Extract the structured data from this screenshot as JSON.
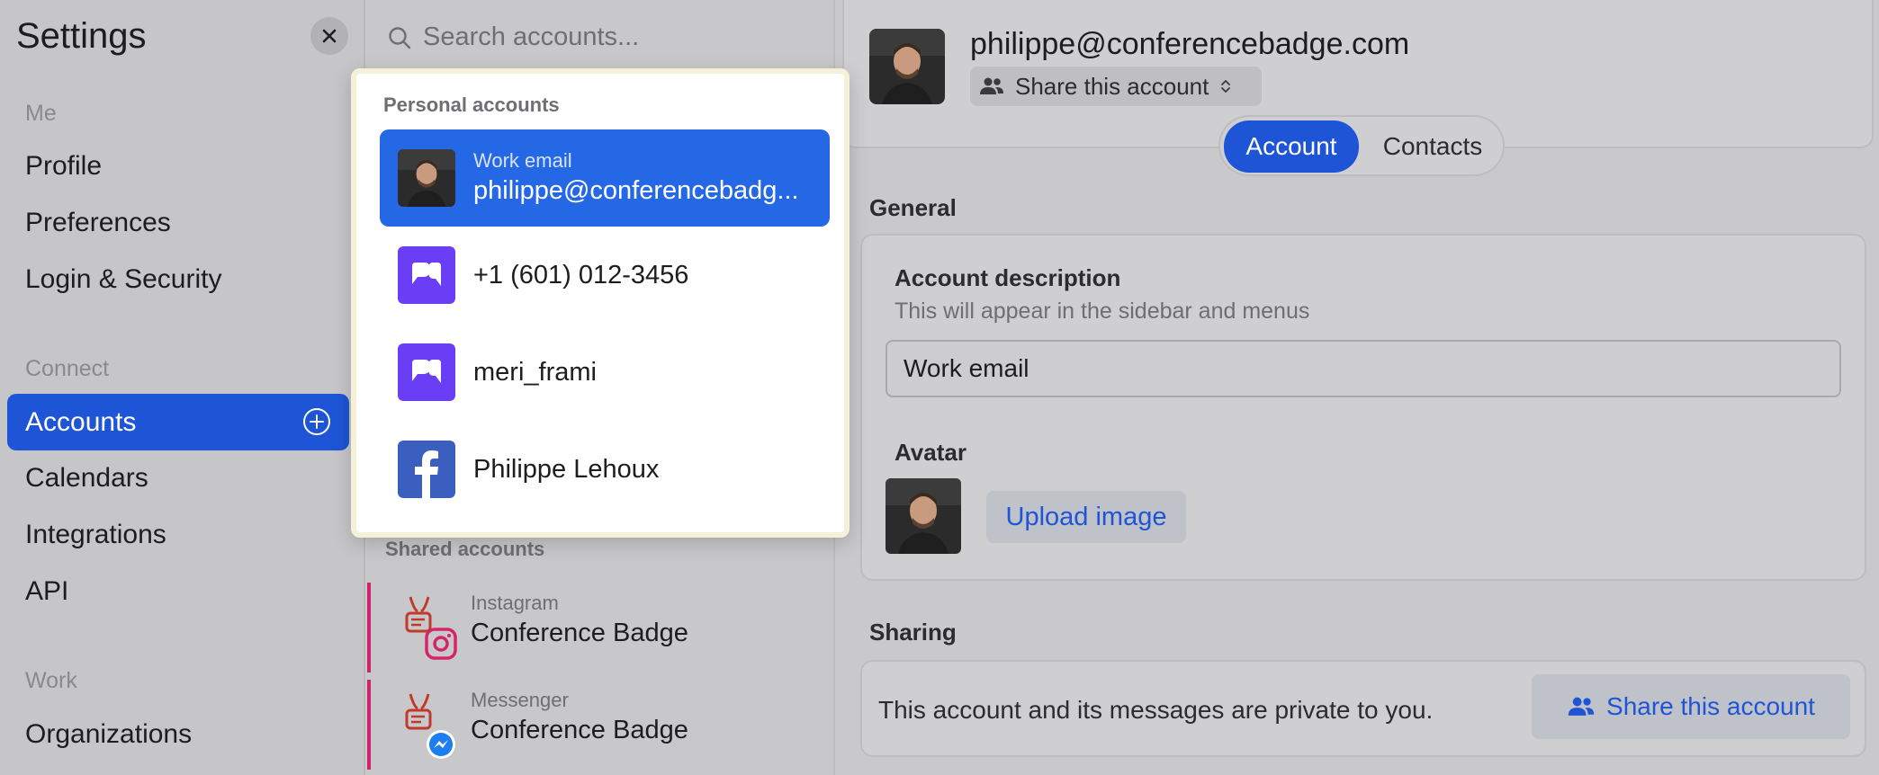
{
  "sidebar": {
    "title": "Settings",
    "sections": [
      {
        "label": "Me",
        "items": [
          "Profile",
          "Preferences",
          "Login & Security"
        ]
      },
      {
        "label": "Connect",
        "items": [
          "Accounts",
          "Calendars",
          "Integrations",
          "API"
        ]
      },
      {
        "label": "Work",
        "items": [
          "Organizations"
        ]
      }
    ],
    "active_item": "Accounts",
    "accent": "#1e55d6"
  },
  "search": {
    "placeholder": "Search accounts..."
  },
  "dropdown": {
    "personal_header": "Personal accounts",
    "items": [
      {
        "subtitle": "Work email",
        "label": "philippe@conferencebadg...",
        "icon": "avatar-photo",
        "selected": true
      },
      {
        "label": "+1 (601) 012-3456",
        "icon": "beeper-icon"
      },
      {
        "label": "meri_frami",
        "icon": "beeper-icon"
      },
      {
        "label": "Philippe Lehoux",
        "icon": "facebook-icon"
      }
    ],
    "selected_color": "#2468e6"
  },
  "shared": {
    "header": "Shared accounts",
    "items": [
      {
        "subtitle": "Instagram",
        "label": "Conference Badge",
        "icon": "instagram-icon"
      },
      {
        "subtitle": "Messenger",
        "label": "Conference Badge",
        "icon": "messenger-icon"
      }
    ]
  },
  "detail": {
    "email": "philippe@conferencebadge.com",
    "share_label": "Share this account",
    "tabs": [
      "Account",
      "Contacts"
    ],
    "active_tab": "Account",
    "general": {
      "title": "General",
      "description_label": "Account description",
      "description_help": "This will appear in the sidebar and menus",
      "description_value": "Work email",
      "avatar_label": "Avatar",
      "upload_label": "Upload image"
    },
    "sharing": {
      "title": "Sharing",
      "text": "This account and its messages are private to you.",
      "button": "Share this account"
    }
  }
}
